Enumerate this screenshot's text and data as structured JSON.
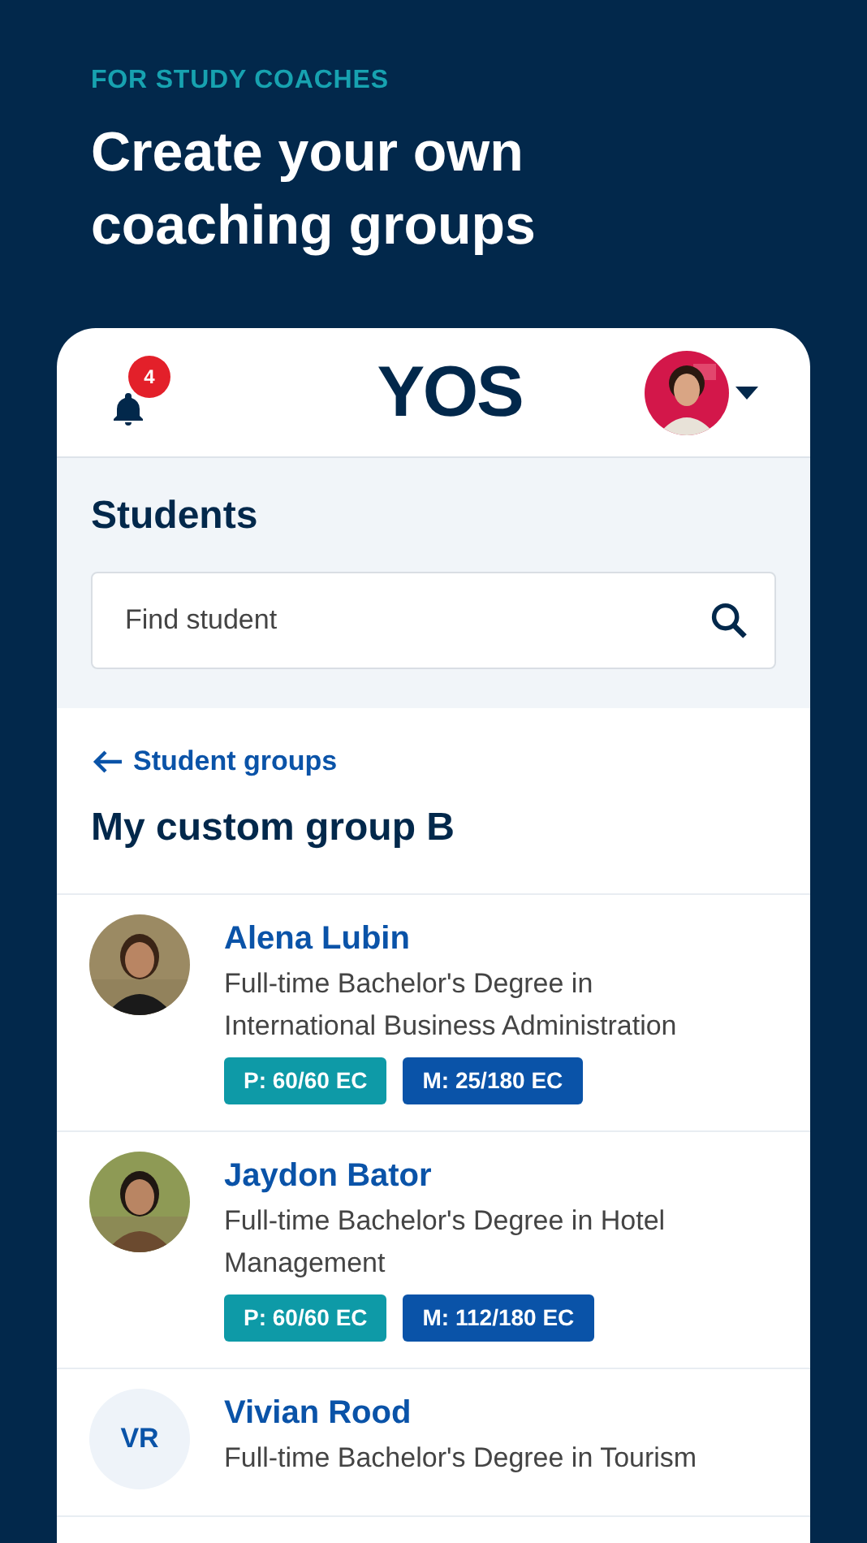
{
  "eyebrow": "FOR STUDY COACHES",
  "headline": "Create your own coaching groups",
  "app_bar": {
    "logo": "YOS",
    "notification_count": "4"
  },
  "students": {
    "title": "Students",
    "search": {
      "placeholder": "Find student"
    }
  },
  "group": {
    "back_link": "Student groups",
    "title": "My custom group B"
  },
  "student_list": [
    {
      "name": "Alena Lubin",
      "program": "Full-time Bachelor's Degree in International Business Administration",
      "avatar": {
        "kind": "picture"
      },
      "tags": [
        {
          "kind": "propaedeutic",
          "label": "P: 60/60 EC"
        },
        {
          "kind": "main",
          "label": "M: 25/180 EC"
        }
      ]
    },
    {
      "name": "Jaydon Bator",
      "program": "Full-time Bachelor's Degree in Hotel Management",
      "avatar": {
        "kind": "picture"
      },
      "tags": [
        {
          "kind": "propaedeutic",
          "label": "P: 60/60 EC"
        },
        {
          "kind": "main",
          "label": "M: 112/180 EC"
        }
      ]
    },
    {
      "name": "Vivian Rood",
      "program": "Full-time Bachelor's Degree in Tourism",
      "avatar": {
        "kind": "initials",
        "initials": "VR"
      }
    }
  ]
}
